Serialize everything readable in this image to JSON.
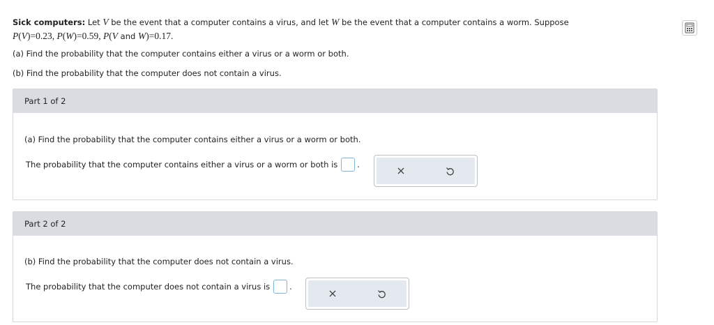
{
  "intro": {
    "title": "Sick computers:",
    "text_1": " Let ",
    "var_v": "V",
    "text_2": " be the event that a computer contains a virus, and let ",
    "var_w": "W",
    "text_3": " be the event that a computer contains a worm. Suppose",
    "formula_p1": "P",
    "formula_v": "V",
    "formula_eq1": "=0.23, ",
    "formula_p2": "P",
    "formula_w": "W",
    "formula_eq2": "=0.59, ",
    "formula_p3": "P",
    "formula_v2": "V",
    "formula_and": " and ",
    "formula_w2": "W",
    "formula_eq3": "=0.17."
  },
  "questions": {
    "a": "(a) Find the probability that the computer contains either a virus or a worm or both.",
    "b": "(b) Find the probability that the computer does not contain a virus."
  },
  "part1": {
    "header": "Part 1 of 2",
    "question": "(a) Find the probability that the computer contains either a virus or a worm or both.",
    "answer_prompt": "The probability that the computer contains either a virus or a worm or both is",
    "answer_value": ""
  },
  "part2": {
    "header": "Part 2 of 2",
    "question": "(b) Find the probability that the computer does not contain a virus.",
    "answer_prompt": "The probability that the computer does not contain a virus is",
    "answer_value": ""
  },
  "tools": {
    "clear_icon": "×",
    "undo_icon": "undo-icon"
  },
  "colors": {
    "panel_header": "#d9dde1",
    "tools_bg": "#e3e9ee",
    "input_border": "#7fb5d6"
  }
}
